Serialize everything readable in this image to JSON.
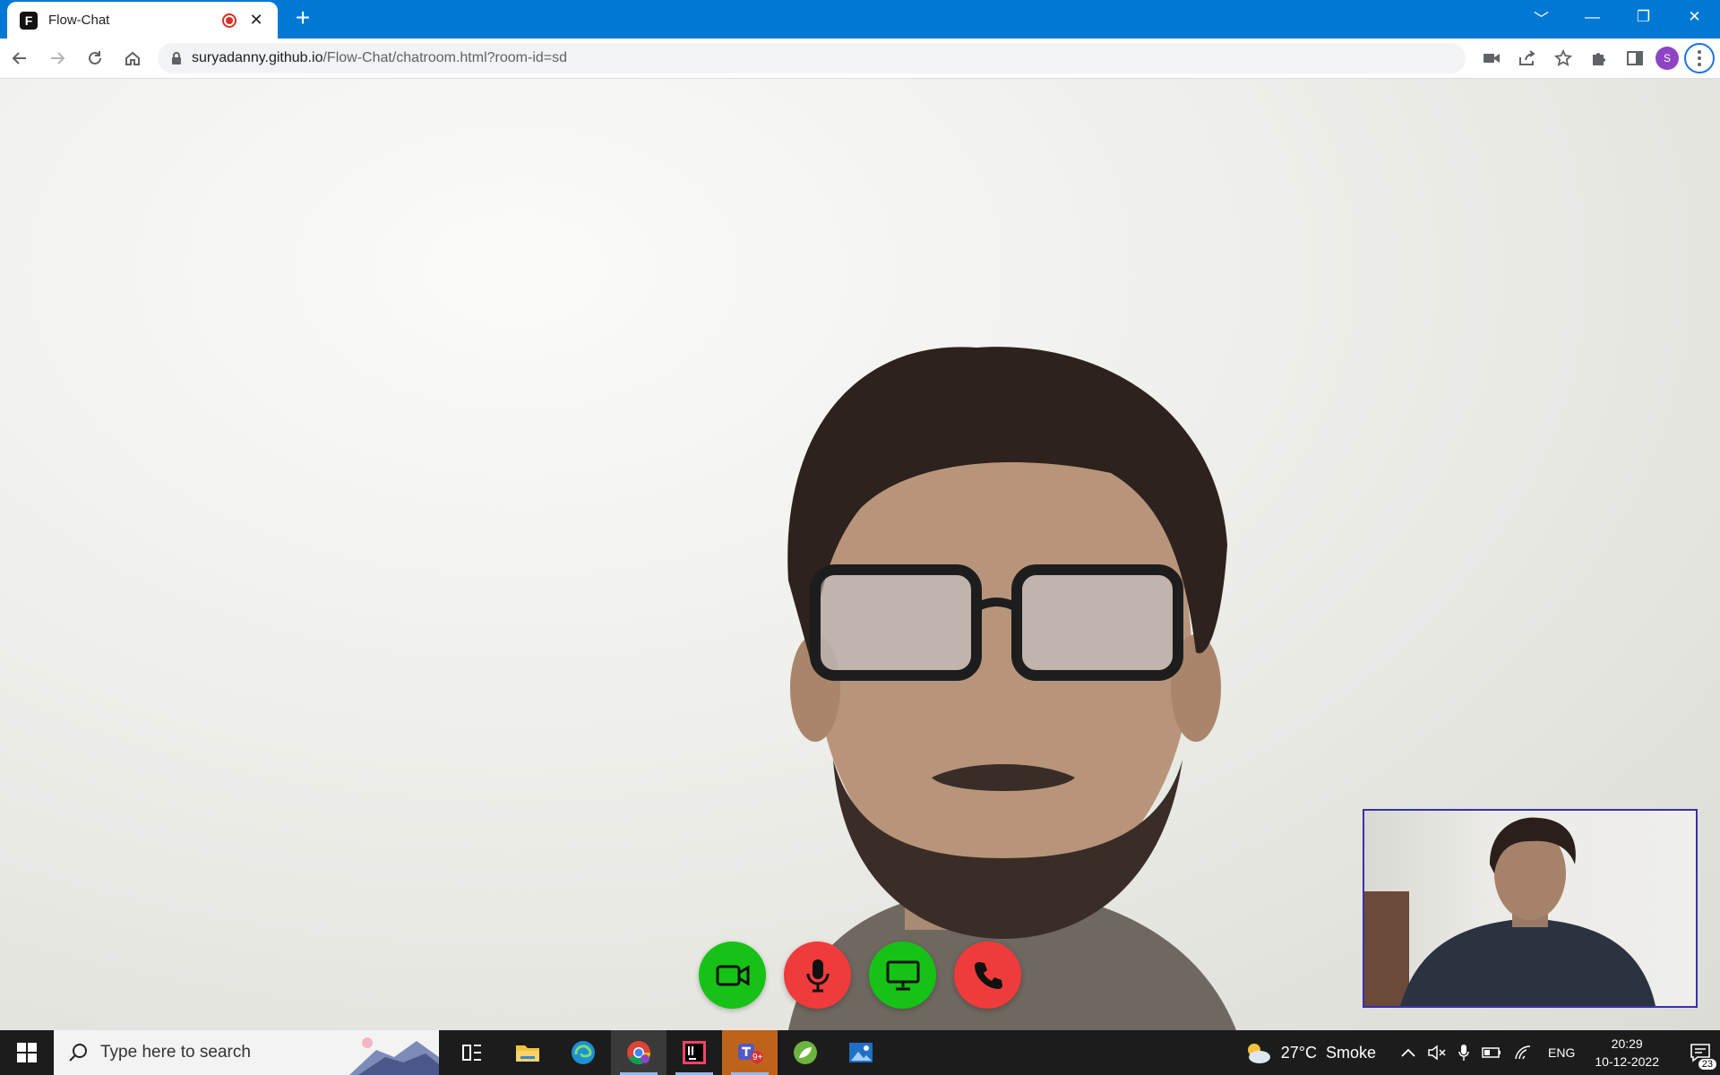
{
  "browser": {
    "tab": {
      "title": "Flow-Chat",
      "favicon_letter": "F",
      "close_glyph": "✕"
    },
    "new_tab_glyph": "+",
    "window_controls": [
      "﹀",
      "—",
      "❐",
      "✕"
    ],
    "url": {
      "host": "suryadanny.github.io",
      "path": "/Flow-Chat/chatroom.html?room-id=sd"
    },
    "profile_initial": "S"
  },
  "call": {
    "controls": [
      {
        "name": "video-toggle",
        "color": "#16c216",
        "icon": "video-camera-icon"
      },
      {
        "name": "mic-toggle",
        "color": "#ef3b3b",
        "icon": "microphone-icon"
      },
      {
        "name": "screen-share",
        "color": "#16c216",
        "icon": "monitor-icon"
      },
      {
        "name": "end-call",
        "color": "#ef3b3b",
        "icon": "phone-icon"
      }
    ]
  },
  "taskbar": {
    "search_placeholder": "Type here to search",
    "weather": {
      "temp": "27°C",
      "condition": "Smoke"
    },
    "language": "ENG",
    "time": "20:29",
    "date": "10-12-2022",
    "notification_count": "23",
    "teams_badge": "9+"
  }
}
